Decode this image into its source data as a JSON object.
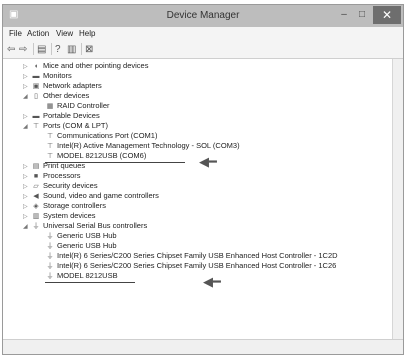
{
  "window": {
    "title": "Device Manager",
    "icon": "device-manager-icon"
  },
  "titlebar_buttons": {
    "minimize": "–",
    "maximize": "□",
    "close": "✕"
  },
  "menu": [
    "File",
    "Action",
    "View",
    "Help"
  ],
  "toolbar_icons": [
    "back-icon",
    "forward-icon",
    "properties-icon",
    "help-icon",
    "view-icon",
    "scan-hardware-icon"
  ],
  "tree": [
    {
      "label": "Mice and other pointing devices",
      "expanded": false,
      "level": 1,
      "icon": "mouse-icon"
    },
    {
      "label": "Monitors",
      "expanded": false,
      "level": 1,
      "icon": "monitor-icon"
    },
    {
      "label": "Network adapters",
      "expanded": false,
      "level": 1,
      "icon": "network-icon"
    },
    {
      "label": "Other devices",
      "expanded": true,
      "level": 1,
      "icon": "other-devices-icon"
    },
    {
      "label": "RAID Controller",
      "level": 2,
      "icon": "unknown-device-icon"
    },
    {
      "label": "Portable Devices",
      "expanded": false,
      "level": 1,
      "icon": "portable-icon"
    },
    {
      "label": "Ports (COM & LPT)",
      "expanded": true,
      "level": 1,
      "icon": "port-icon"
    },
    {
      "label": "Communications Port (COM1)",
      "level": 2,
      "icon": "port-icon"
    },
    {
      "label": "Intel(R) Active Management Technology - SOL (COM3)",
      "level": 2,
      "icon": "port-icon"
    },
    {
      "label": "MODEL 8212USB (COM6)",
      "level": 2,
      "icon": "port-icon",
      "highlighted": true
    },
    {
      "label": "Print queues",
      "expanded": false,
      "level": 1,
      "icon": "printer-icon"
    },
    {
      "label": "Processors",
      "expanded": false,
      "level": 1,
      "icon": "processor-icon"
    },
    {
      "label": "Security devices",
      "expanded": false,
      "level": 1,
      "icon": "security-icon"
    },
    {
      "label": "Sound, video and game controllers",
      "expanded": false,
      "level": 1,
      "icon": "sound-icon"
    },
    {
      "label": "Storage controllers",
      "expanded": false,
      "level": 1,
      "icon": "storage-icon"
    },
    {
      "label": "System devices",
      "expanded": false,
      "level": 1,
      "icon": "system-icon"
    },
    {
      "label": "Universal Serial Bus controllers",
      "expanded": true,
      "level": 1,
      "icon": "usb-icon"
    },
    {
      "label": "Generic USB Hub",
      "level": 2,
      "icon": "usb-icon"
    },
    {
      "label": "Generic USB Hub",
      "level": 2,
      "icon": "usb-icon"
    },
    {
      "label": "Intel(R) 6 Series/C200 Series Chipset Family USB Enhanced Host Controller - 1C2D",
      "level": 2,
      "icon": "usb-icon"
    },
    {
      "label": "Intel(R) 6 Series/C200 Series Chipset Family USB Enhanced Host Controller - 1C26",
      "level": 2,
      "icon": "usb-icon"
    },
    {
      "label": "MODEL 8212USB",
      "level": 2,
      "icon": "usb-icon",
      "highlighted": true
    }
  ],
  "colors": {
    "titlebar": "#bdbdbd",
    "close_button": "#6e6e6e",
    "highlight_line": "#444444"
  }
}
